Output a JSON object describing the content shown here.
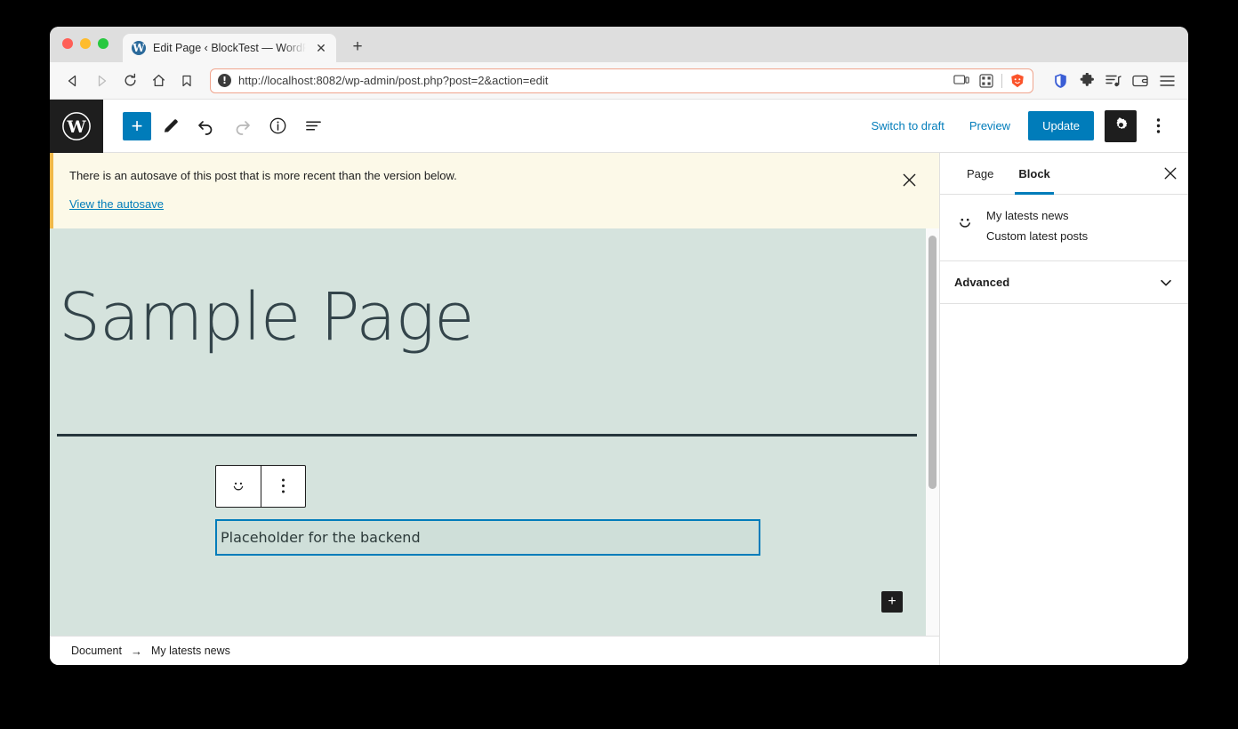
{
  "browser": {
    "tab": {
      "title": "Edit Page ‹ BlockTest — WordPr",
      "favicon": "wordpress-icon",
      "close_label": "✕"
    },
    "new_tab_label": "+",
    "nav": {
      "back": "back-icon",
      "forward": "forward-icon",
      "reload": "reload-icon",
      "home": "home-icon",
      "bookmark": "bookmark-icon"
    },
    "url": "http://localhost:8082/wp-admin/post.php?post=2&action=edit",
    "url_security_icon": "not-secure-icon",
    "url_right_icons": [
      "cast-icon",
      "qr-code-icon",
      "brave-shields-icon"
    ],
    "extension_icons": [
      "brave-wallet-shield-icon",
      "extensions-puzzle-icon",
      "playlist-icon",
      "wallet-icon",
      "menu-hamburger-icon"
    ]
  },
  "editor_header": {
    "logo": "wordpress-logo",
    "add_block_label": "+",
    "tools": [
      "edit-pencil-icon",
      "undo-icon",
      "redo-icon",
      "info-icon",
      "list-view-icon"
    ],
    "switch_to_draft_label": "Switch to draft",
    "preview_label": "Preview",
    "update_label": "Update",
    "settings_icon": "settings-gear-icon",
    "more_options_icon": "more-options-icon",
    "accent_color": "#007cba"
  },
  "notice": {
    "message": "There is an autosave of this post that is more recent than the version below.",
    "link_label": "View the autosave",
    "close_label": "✕",
    "background": "#fcf9e8",
    "border_color": "#f0b849"
  },
  "canvas": {
    "post_title": "Sample Page",
    "background": "#d5e3dd",
    "block_toolbar": {
      "block_icon": "smiley-face-icon",
      "options_icon": "more-options-icon"
    },
    "selected_block_text": "Placeholder for the backend",
    "selected_block_border": "#007cba",
    "appender_label": "+"
  },
  "breadcrumb": {
    "root": "Document",
    "arrow": "→",
    "current": "My latests news"
  },
  "sidebar": {
    "tabs": [
      {
        "label": "Page",
        "active": false
      },
      {
        "label": "Block",
        "active": true
      }
    ],
    "close_label": "✕",
    "block_card": {
      "icon": "smiley-face-icon",
      "title": "My latests news",
      "description": "Custom latest posts"
    },
    "panels": [
      {
        "label": "Advanced",
        "expanded": false,
        "chevron": "chevron-down-icon"
      }
    ]
  }
}
